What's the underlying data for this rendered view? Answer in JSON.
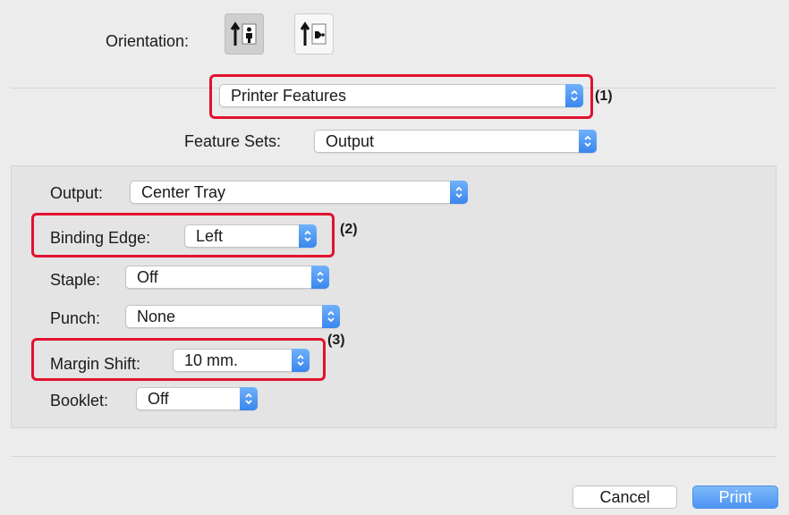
{
  "orientation": {
    "label": "Orientation:",
    "options": [
      {
        "icon": "portrait-orientation-icon",
        "selected": true
      },
      {
        "icon": "landscape-orientation-icon",
        "selected": false
      }
    ]
  },
  "panel_selector": {
    "value": "Printer Features"
  },
  "feature_sets": {
    "label": "Feature Sets:",
    "value": "Output"
  },
  "settings": {
    "output": {
      "label": "Output:",
      "value": "Center Tray"
    },
    "binding_edge": {
      "label": "Binding Edge:",
      "value": "Left"
    },
    "staple": {
      "label": "Staple:",
      "value": "Off"
    },
    "punch": {
      "label": "Punch:",
      "value": "None"
    },
    "margin_shift": {
      "label": "Margin Shift:",
      "value": "10 mm."
    },
    "booklet": {
      "label": "Booklet:",
      "value": "Off"
    }
  },
  "callouts": {
    "one": "(1)",
    "two": "(2)",
    "three": "(3)"
  },
  "buttons": {
    "cancel": "Cancel",
    "print": "Print"
  },
  "colors": {
    "accent": "#3a86ee",
    "callout": "#e2112f"
  }
}
